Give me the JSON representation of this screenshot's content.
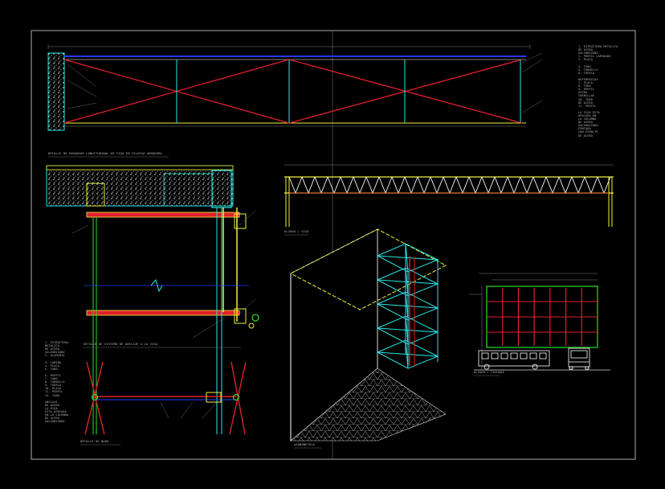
{
  "colors": {
    "background": "#000000",
    "frame": "#d8d8d8",
    "red": "#e0202a",
    "cyan": "#27e8e8",
    "yellow": "#f0f040",
    "blue": "#2838ff",
    "green": "#28e028",
    "white": "#ffffff",
    "gray": "#a0a0a0",
    "text": "#b8b8b8"
  },
  "captions": {
    "truss_section": "DETALLE DE ENGANCHE LONGITUDINAL DE VIGA EN CELOSIA ARMADURA",
    "wall_detail": "DETALLE DE SISTEMA DE ANCLAJE A LA VIGA",
    "truss_elevation": "ALZADO / VIGA",
    "isometric": "AXONOMETRIA",
    "facade": "ALZADO / FACHADA",
    "node_detail": "DETALLE DE NUDO"
  },
  "notes": {
    "right": "1. ESTRUCTURA METALICA\nDE ACERO\nGALVANIZADO\n2. PERFIL LAMINADO\n3. PLACA\n\n4. TUBO\n5. TORNILLO\n6. TUERCA\n\nREFERENCIAS\n7. PLACA\n8. TUBO\n9. PERFIL\nACERO\nTORNILLOS\n10. TUBO\nDE ACERO\n11. PERFIL\n\nLA VIGA ESTA\nAPOYADA EN\nLA COLUMNA\nDE ACERO\nGALVANIZADO\nPINTADA\nCON ESMALTE\nDE ACERO",
    "left": "1. ESTRUCTURA\nMETALICA\nDE ACERO\nGALVANIZADO\n2. ALUMINIO\n\n3. LAMINA\n4. PLACA\n5. TUBO\n\n6. PERFIL\n7. TUBO\n8. TORNILLO\n9. TUERCA\n10. PLACA\n11. PERFIL\n12. TUBO\n\nANCLAJE\nDE ACERO\nLA VIGA\nESTA APOYADA\nEN LA COLUMNA\nDE ACERO\nGALVANIZADO"
  }
}
